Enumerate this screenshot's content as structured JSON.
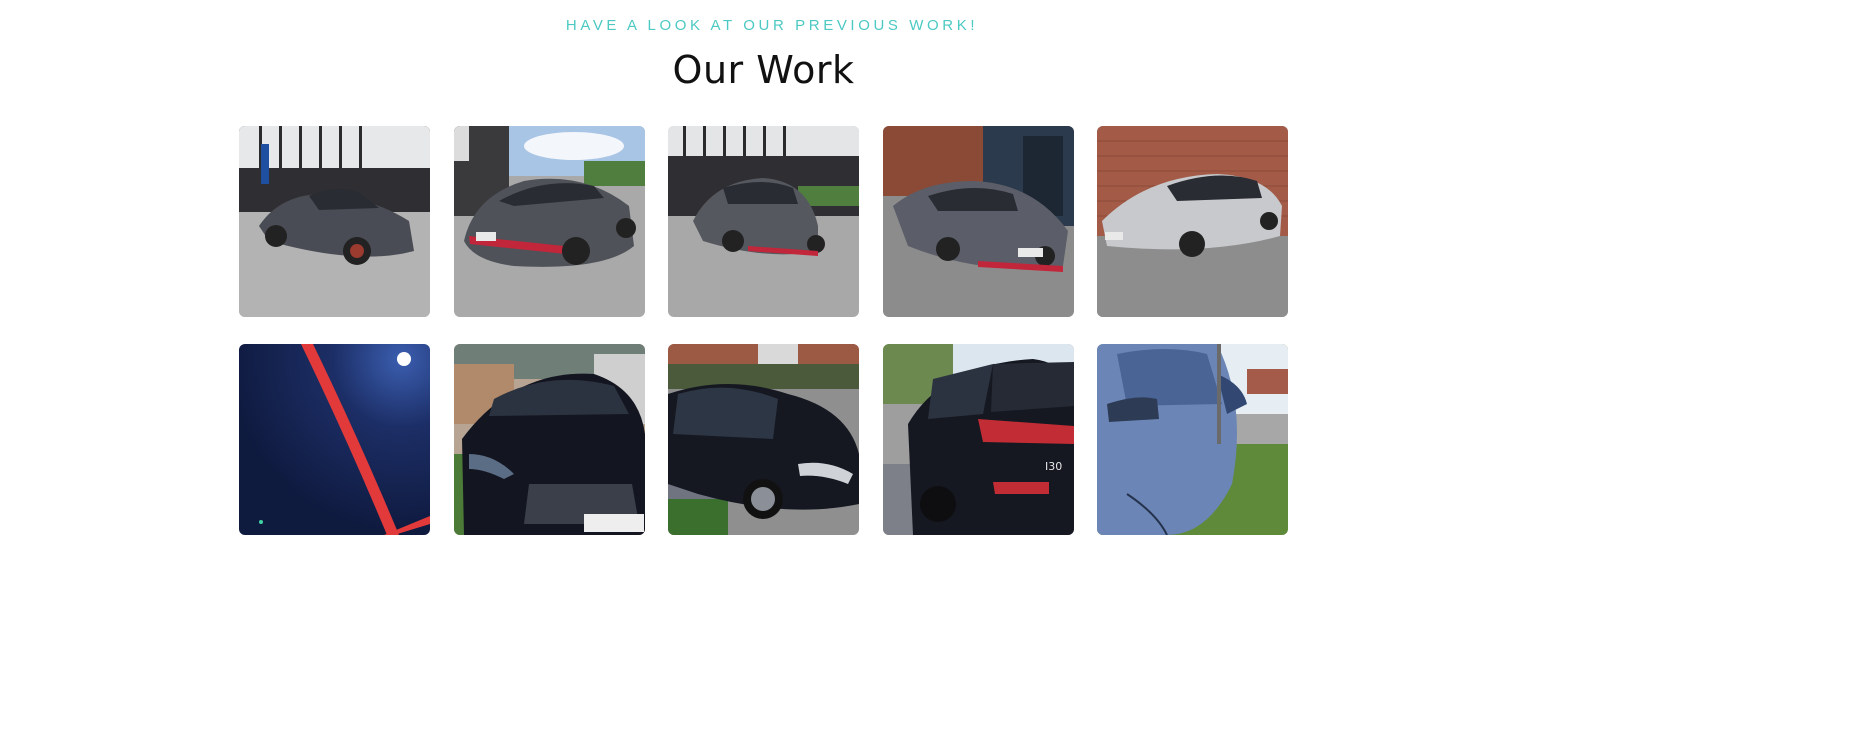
{
  "section": {
    "eyebrow": "HAVE A LOOK AT OUR PREVIOUS WORK!",
    "title": "Our Work"
  },
  "gallery": {
    "items": [
      {
        "name": "gallery-photo-1",
        "subject": "grey hatchback car-photo-icon"
      },
      {
        "name": "gallery-photo-2",
        "subject": "grey hatchback rear car-photo-icon",
        "plate": "FX·30"
      },
      {
        "name": "gallery-photo-3",
        "subject": "grey hatchback front car-photo-icon"
      },
      {
        "name": "gallery-photo-4",
        "subject": "grey hatchback front car-photo-icon"
      },
      {
        "name": "gallery-photo-5",
        "subject": "silver sedan car-photo-icon"
      },
      {
        "name": "gallery-photo-6",
        "subject": "paint close-up car-photo-icon"
      },
      {
        "name": "gallery-photo-7",
        "subject": "black hatchback front car-photo-icon",
        "plate": "DPH·52"
      },
      {
        "name": "gallery-photo-8",
        "subject": "black hatchback side car-photo-icon"
      },
      {
        "name": "gallery-photo-9",
        "subject": "black hatchback rear car-photo-icon",
        "badge": "I30"
      },
      {
        "name": "gallery-photo-10",
        "subject": "blue car door close-up car-photo-icon"
      }
    ]
  },
  "colors": {
    "accent": "#4cc9c3",
    "title": "#111111",
    "background": "#ffffff"
  }
}
